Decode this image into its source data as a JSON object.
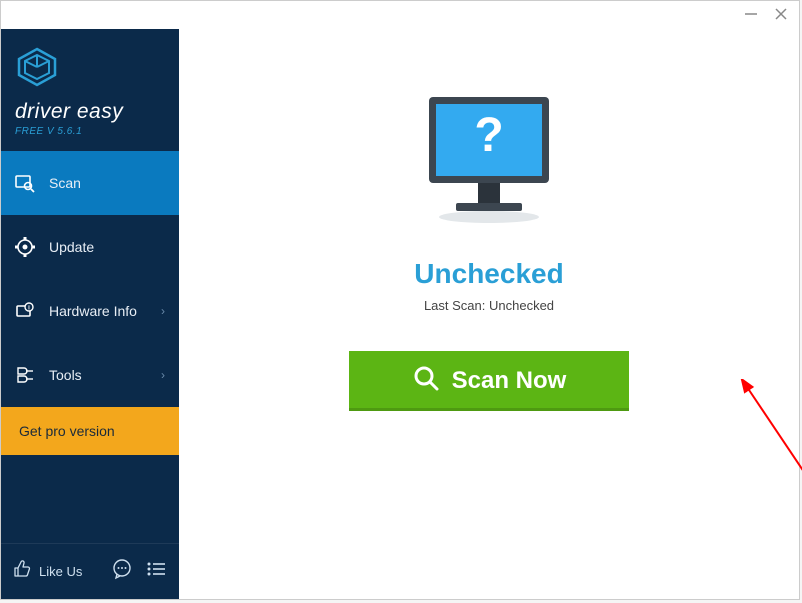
{
  "app": {
    "name": "driver easy",
    "subtitle": "FREE V 5.6.1"
  },
  "sidebar": {
    "items": [
      {
        "label": "Scan",
        "active": true,
        "chevron": false
      },
      {
        "label": "Update",
        "active": false,
        "chevron": false
      },
      {
        "label": "Hardware Info",
        "active": false,
        "chevron": true
      },
      {
        "label": "Tools",
        "active": false,
        "chevron": true
      }
    ],
    "pro_label": "Get pro version",
    "like_label": "Like Us"
  },
  "main": {
    "status_title": "Unchecked",
    "status_sub": "Last Scan: Unchecked",
    "scan_button": "Scan Now"
  }
}
